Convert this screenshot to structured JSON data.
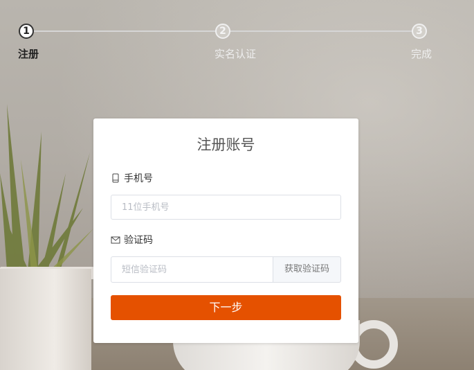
{
  "steps": [
    {
      "number": "1",
      "label": "注册",
      "state": "active"
    },
    {
      "number": "2",
      "label": "实名认证",
      "state": "pending"
    },
    {
      "number": "3",
      "label": "完成",
      "state": "pending"
    }
  ],
  "form": {
    "title": "注册账号",
    "phone": {
      "label": "手机号",
      "placeholder": "11位手机号",
      "value": "",
      "icon": "mobile-phone-icon"
    },
    "code": {
      "label": "验证码",
      "placeholder": "短信验证码",
      "value": "",
      "icon": "envelope-icon",
      "button_label": "获取验证码"
    },
    "next_button_label": "下一步"
  },
  "colors": {
    "primary_button": "#e55100",
    "step_active": "#333333",
    "step_pending": "#f0f0f0"
  }
}
